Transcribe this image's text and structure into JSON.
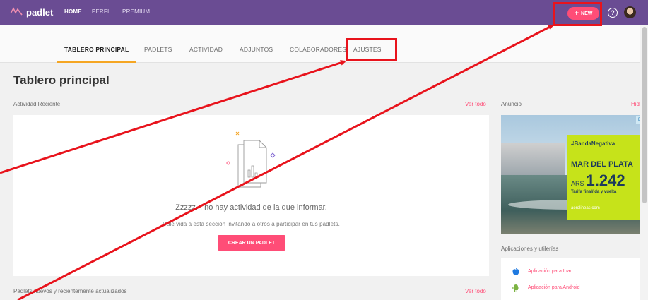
{
  "brand": {
    "name": "padlet"
  },
  "topnav": [
    "HOME",
    "PERFIL",
    "PREMIUM"
  ],
  "new_button": {
    "label": "NEW"
  },
  "help_icon": "?",
  "tabs": [
    "TABLERO PRINCIPAL",
    "PADLETS",
    "ACTIVIDAD",
    "ADJUNTOS",
    "COLABORADORES",
    "AJUSTES"
  ],
  "page_title": "Tablero principal",
  "activity": {
    "label": "Actividad Reciente",
    "see_all": "Ver todo",
    "empty_title": "Zzzzz... no hay actividad de la que informar.",
    "empty_sub": "Dale vida a esta sección invitando a otros a participar en tus padlets.",
    "create_button": "CREAR UN PADLET"
  },
  "recent_padlets": {
    "label": "Padlets nuevos y recientemente actualizados",
    "see_all": "Ver todo"
  },
  "ad": {
    "label": "Anuncio",
    "hide": "Hide",
    "hashtag": "#BandaNegativa",
    "city": "MAR DEL PLATA",
    "currency": "ARS",
    "price": "1.242",
    "fare_note": "Tarifa final/ida y vuelta",
    "airline": "aerolineas.com",
    "corner": "D|X"
  },
  "apps": {
    "label": "Aplicaciones y utilerías",
    "items": [
      {
        "label": "Aplicación para Ipad",
        "icon": "apple-icon"
      },
      {
        "label": "Aplicación para Android",
        "icon": "android-icon"
      }
    ]
  },
  "colors": {
    "header": "#6a4c93",
    "accent": "#ff4d77",
    "tab_underline": "#f5a623",
    "annotation": "#e8131c"
  }
}
